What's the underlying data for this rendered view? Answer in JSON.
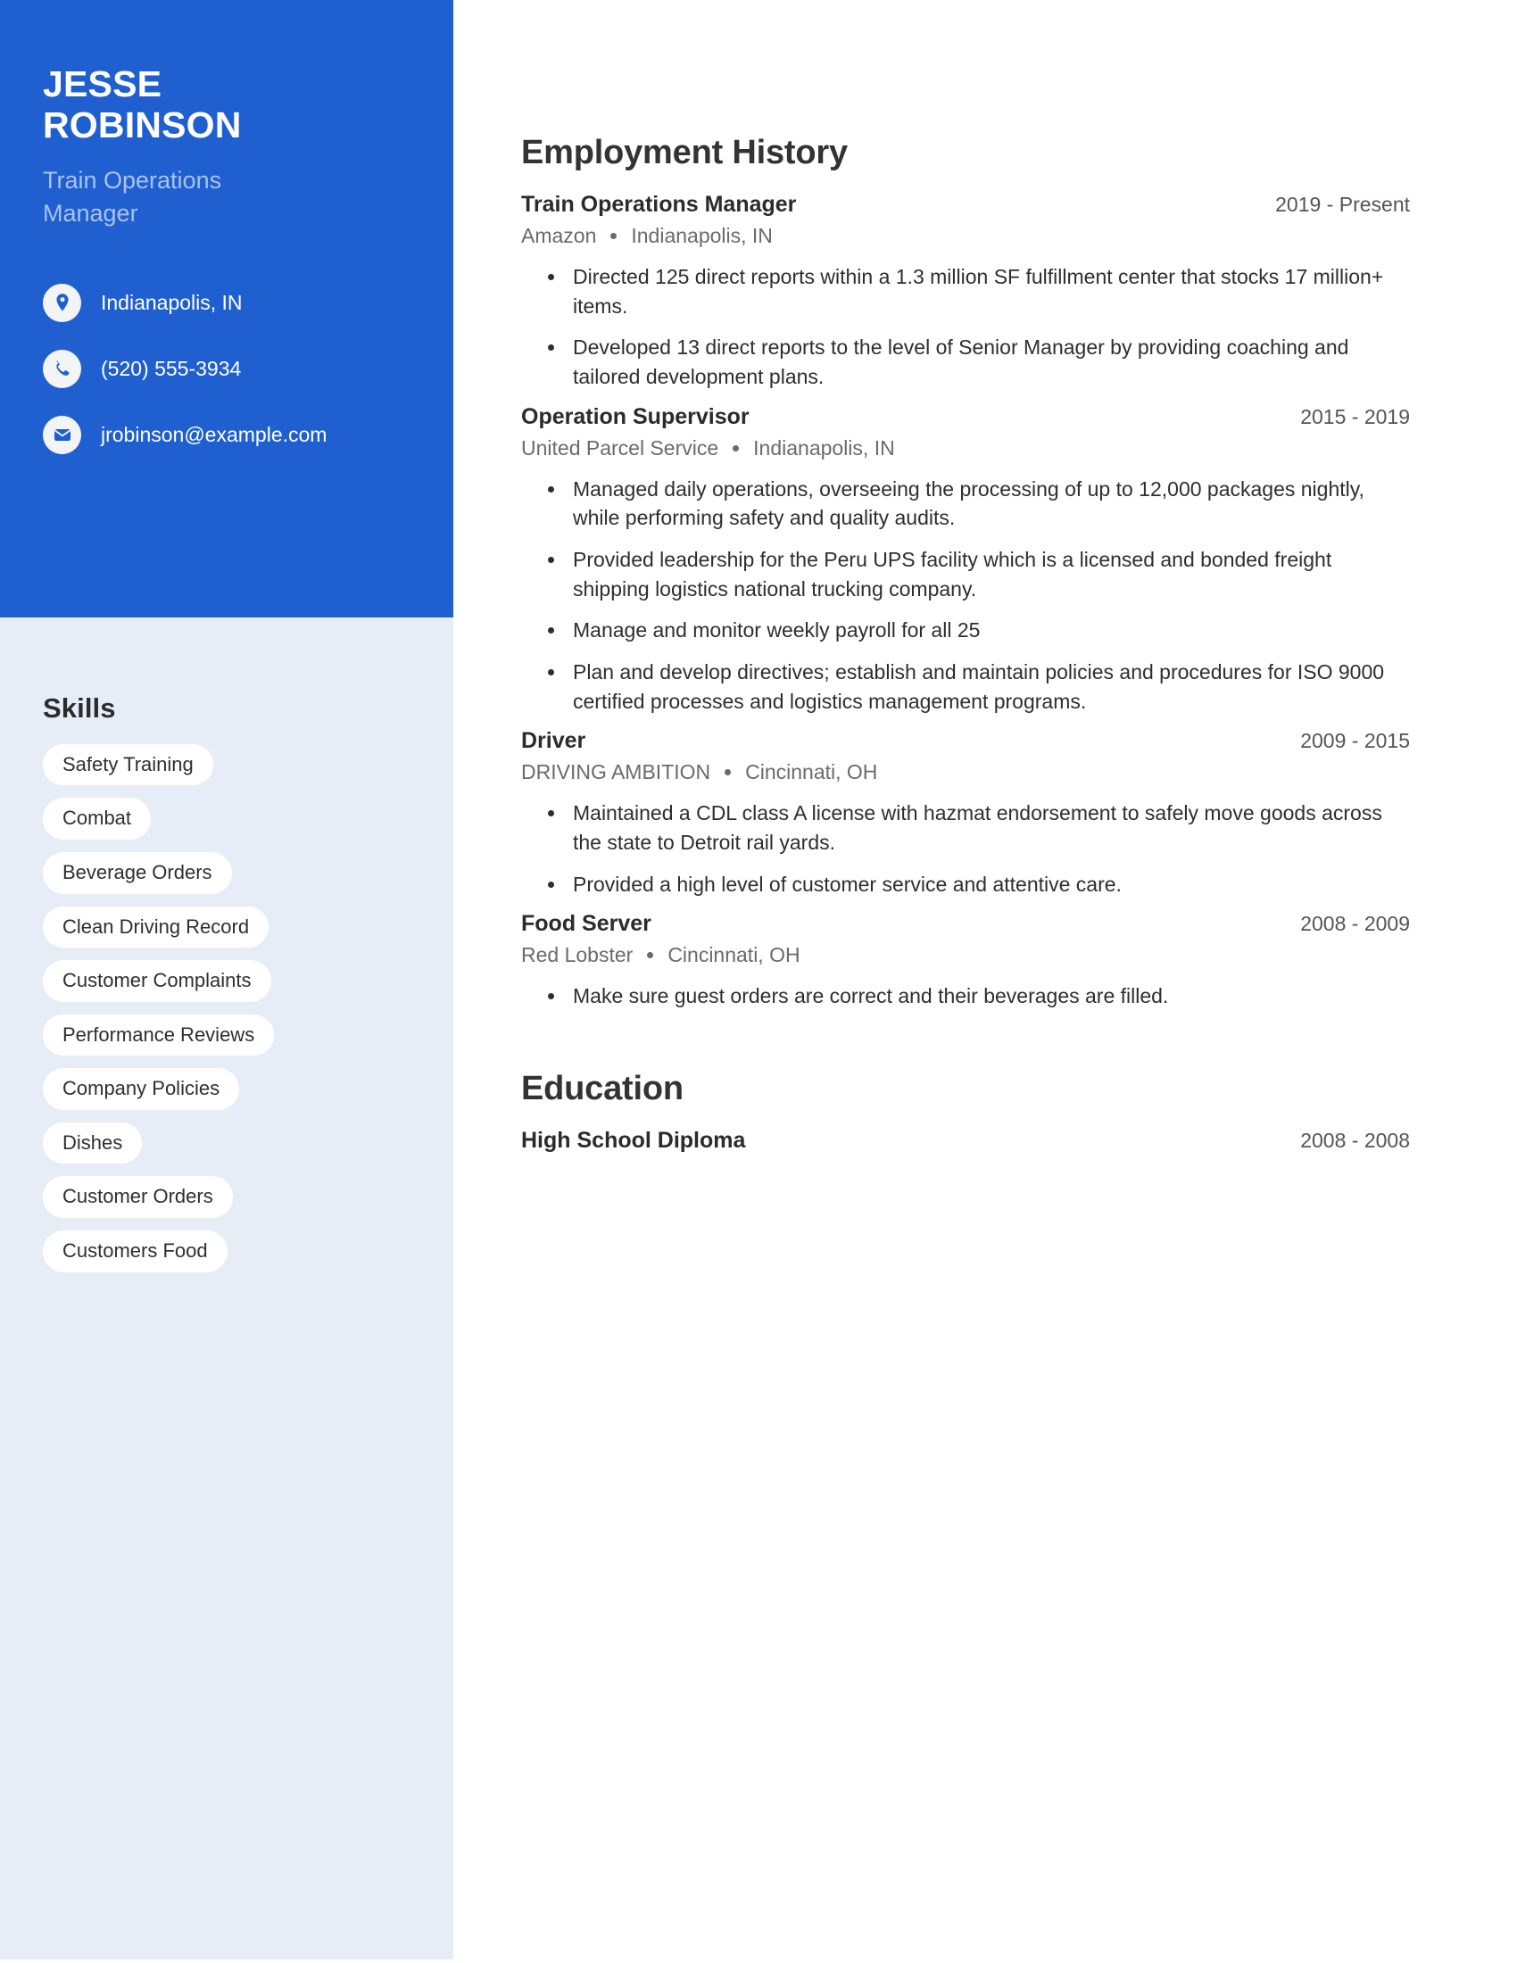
{
  "colors": {
    "accent_blue": "#1f5fd0",
    "sidebar_bg": "#e7edf7",
    "role_text": "#a9c3ea",
    "pill_bg": "#ffffff",
    "body_text": "#2e2e2e",
    "muted_text": "#6a6a6a"
  },
  "sidebar": {
    "name": {
      "first": "JESSE",
      "last": "ROBINSON"
    },
    "role": {
      "line1": "Train Operations",
      "line2": "Manager"
    },
    "contacts": [
      {
        "icon": "location-pin-icon",
        "value": "Indianapolis, IN"
      },
      {
        "icon": "phone-icon",
        "value": "(520) 555-3934"
      },
      {
        "icon": "envelope-icon",
        "value": "jrobinson@example.com"
      }
    ],
    "skills": {
      "title": "Skills",
      "items": [
        "Safety Training",
        "Combat",
        "Beverage Orders",
        "Clean Driving Record",
        "Customer Complaints",
        "Performance Reviews",
        "Company Policies",
        "Dishes",
        "Customer Orders",
        "Customers Food"
      ]
    }
  },
  "main": {
    "employment": {
      "title": "Employment History",
      "jobs": [
        {
          "title": "Train Operations Manager",
          "date": "2019 - Present",
          "company": "Amazon",
          "location": "Indianapolis, IN",
          "bullets": [
            "Directed 125 direct reports within a 1.3 million SF fulfillment center that stocks 17 million+ items.",
            "Developed 13 direct reports to the level of Senior Manager by providing coaching and tailored development plans."
          ]
        },
        {
          "title": "Operation Supervisor",
          "date": "2015 - 2019",
          "company": "United Parcel Service",
          "location": "Indianapolis, IN",
          "bullets": [
            "Managed daily operations, overseeing the processing of up to 12,000 packages nightly, while performing safety and quality audits.",
            "Provided leadership for the Peru UPS facility which is a licensed and bonded freight shipping logistics national trucking company.",
            "Manage and monitor weekly payroll for all 25",
            "Plan and develop directives; establish and maintain policies and procedures for ISO 9000 certified processes and logistics management programs."
          ]
        },
        {
          "title": "Driver",
          "date": "2009 - 2015",
          "company": "DRIVING AMBITION",
          "location": "Cincinnati, OH",
          "bullets": [
            "Maintained a CDL class A license with hazmat endorsement to safely move goods across the state to Detroit rail yards.",
            "Provided a high level of customer service and attentive care."
          ]
        },
        {
          "title": "Food Server",
          "date": "2008 - 2009",
          "company": "Red Lobster",
          "location": "Cincinnati, OH",
          "bullets": [
            "Make sure guest orders are correct and their beverages are filled."
          ]
        }
      ]
    },
    "education": {
      "title": "Education",
      "entries": [
        {
          "degree": "High School Diploma",
          "date": "2008 - 2008"
        }
      ]
    }
  }
}
